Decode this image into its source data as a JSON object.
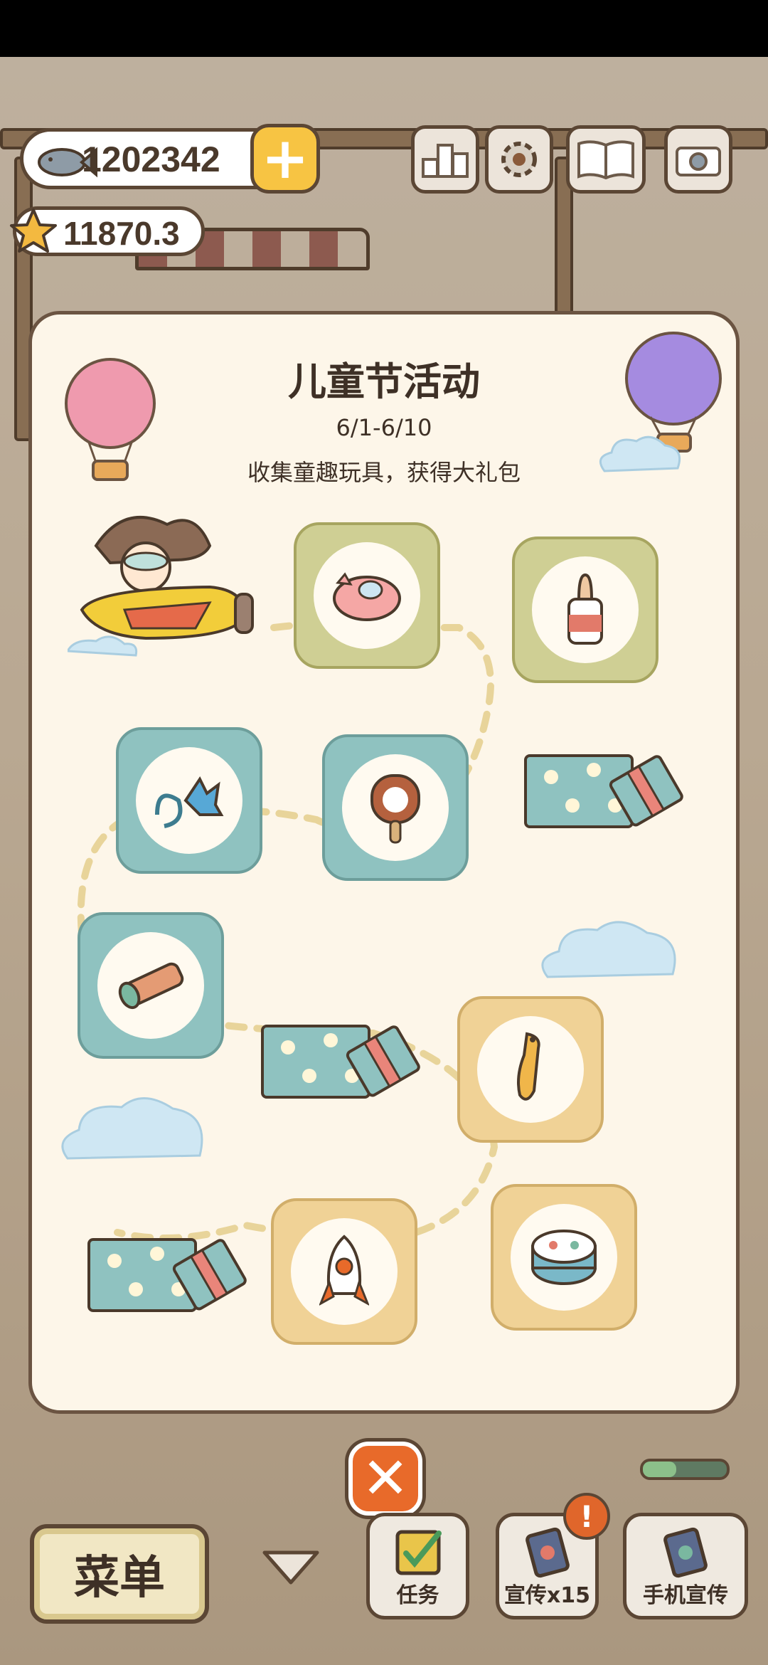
{
  "currency": {
    "fish": "1202342",
    "stars": "11870.3"
  },
  "top_icons": [
    "ranking-icon",
    "settings-gear-icon",
    "book-icon",
    "camera-icon"
  ],
  "event": {
    "title": "儿童节活动",
    "date": "6/1-6/10",
    "description": "收集童趣玩具，获得大礼包"
  },
  "rewards": [
    {
      "name": "pig-toy",
      "kind": "toy",
      "color": "olive"
    },
    {
      "name": "baby-bottle",
      "kind": "toy",
      "color": "olive"
    },
    {
      "name": "gift-box",
      "kind": "gift",
      "color": "teal"
    },
    {
      "name": "paw-popsicle",
      "kind": "toy",
      "color": "teal"
    },
    {
      "name": "sticky-hand",
      "kind": "toy",
      "color": "teal"
    },
    {
      "name": "kaleidoscope",
      "kind": "toy",
      "color": "teal"
    },
    {
      "name": "gift-box",
      "kind": "gift",
      "color": "teal"
    },
    {
      "name": "rubber-chicken",
      "kind": "toy",
      "color": "sand"
    },
    {
      "name": "drum",
      "kind": "toy",
      "color": "sand"
    },
    {
      "name": "rocket-toy",
      "kind": "toy",
      "color": "sand"
    },
    {
      "name": "gift-box",
      "kind": "gift",
      "color": "teal"
    }
  ],
  "bottom": {
    "menu": "菜单",
    "tasks": "任务",
    "promote": "宣传x15",
    "phone_promote": "手机宣传",
    "alert": "!"
  },
  "colors": {
    "accent": "#e86a2a",
    "gold": "#f7c443",
    "outline": "#5b4634"
  }
}
